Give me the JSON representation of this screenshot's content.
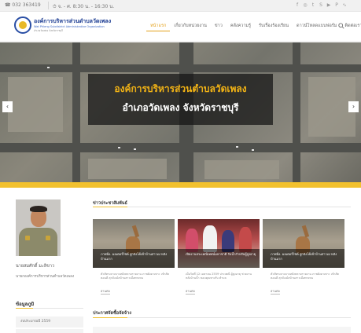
{
  "topbar": {
    "phone": "032 363419",
    "hours": "จ. - ศ. 8:30 น. - 16:30 น.",
    "social": [
      {
        "icon": "facebook-icon",
        "glyph": "f"
      },
      {
        "icon": "instagram-icon",
        "glyph": "◎"
      },
      {
        "icon": "twitter-icon",
        "glyph": "t"
      },
      {
        "icon": "skype-icon",
        "glyph": "S"
      },
      {
        "icon": "youtube-icon",
        "glyph": "▶"
      },
      {
        "icon": "pinterest-icon",
        "glyph": "P"
      },
      {
        "icon": "rss-icon",
        "glyph": "∿"
      }
    ]
  },
  "header": {
    "brand": "องค์การบริหารส่วนตำบลวัดเพลง",
    "brand_sub": "Wat Phleng Subdistrict Administrative Organization",
    "brand_sub2": "อำเภอวัดเพลง จังหวัดราชบุรี",
    "nav": [
      {
        "label": "หน้าแรก",
        "active": true
      },
      {
        "label": "เกี่ยวกับหน่วยงาน",
        "active": false
      },
      {
        "label": "ข่าว",
        "active": false
      },
      {
        "label": "คลังความรู้",
        "active": false
      },
      {
        "label": "รับเรื่องร้องเรียน",
        "active": false
      },
      {
        "label": "ดาวน์โหลดแบบฟอร์ม",
        "active": false
      },
      {
        "label": "ติดต่อเรา",
        "active": false
      }
    ]
  },
  "hero": {
    "line1": "องค์การบริหารส่วนตำบลวัดเพลง",
    "line2": "อำเภอวัดเพลง จังหวัดราชบุรี",
    "prev": "‹",
    "next": "›"
  },
  "sidebar": {
    "name": "นายสมศักดิ์ มะลิขาว",
    "title": "นายกองค์การบริหารส่วนตำบลวัดเพลง",
    "heading": "ข้อมูลภูมิ",
    "item": "งบประมาณปี 2559"
  },
  "news": {
    "heading": "ข่าวประชาสัมพันธ์",
    "more_label": "อ่านต่อ",
    "cards": [
      {
        "title": "ภาพนิ่ง. มอเตอร์ไซค์ สูกจังโค้เข้าบ้านสาวเม่ หลังบ้านมาก",
        "meta": "ตัวลัทรงถางบางหลังหลายรายงาน ภาพยังดาเพาะ เข้าสัตตอนดี สุกจังเม้สบ้านสาวเมื่อทรงหน"
      },
      {
        "title": "เปิดงานประเพณีเทศน์มหาชาติ รับน้ำสำหรับผู้สูงอายุ",
        "meta": "เมื่อวันที่ 12 เมษายน 2559 ประเพณี ผู้สูงอายุ ช่วยงาน หลังบ้านน้ำ ขอบคุณทางรับ ตำบล"
      },
      {
        "title": "ภาพนิ่ง. มอเตอร์ไซค์ สูกจังโค้เข้าบ้านสาวเม่ หลังบ้านมาก",
        "meta": "ตัวลัทรงถางบางหลังหลายรายงาน ภาพยังดาเพาะ เข้าสัตตอนดี สุกจังเม้สบ้านสาวเมื่อทรงหน"
      }
    ]
  },
  "procurement": {
    "heading": "ประกาศจัดซื้อจัดจ้าง"
  },
  "colors": {
    "accent": "#f2c12e",
    "brand_blue": "#1f3f94",
    "nav_active": "#e4a11b"
  }
}
